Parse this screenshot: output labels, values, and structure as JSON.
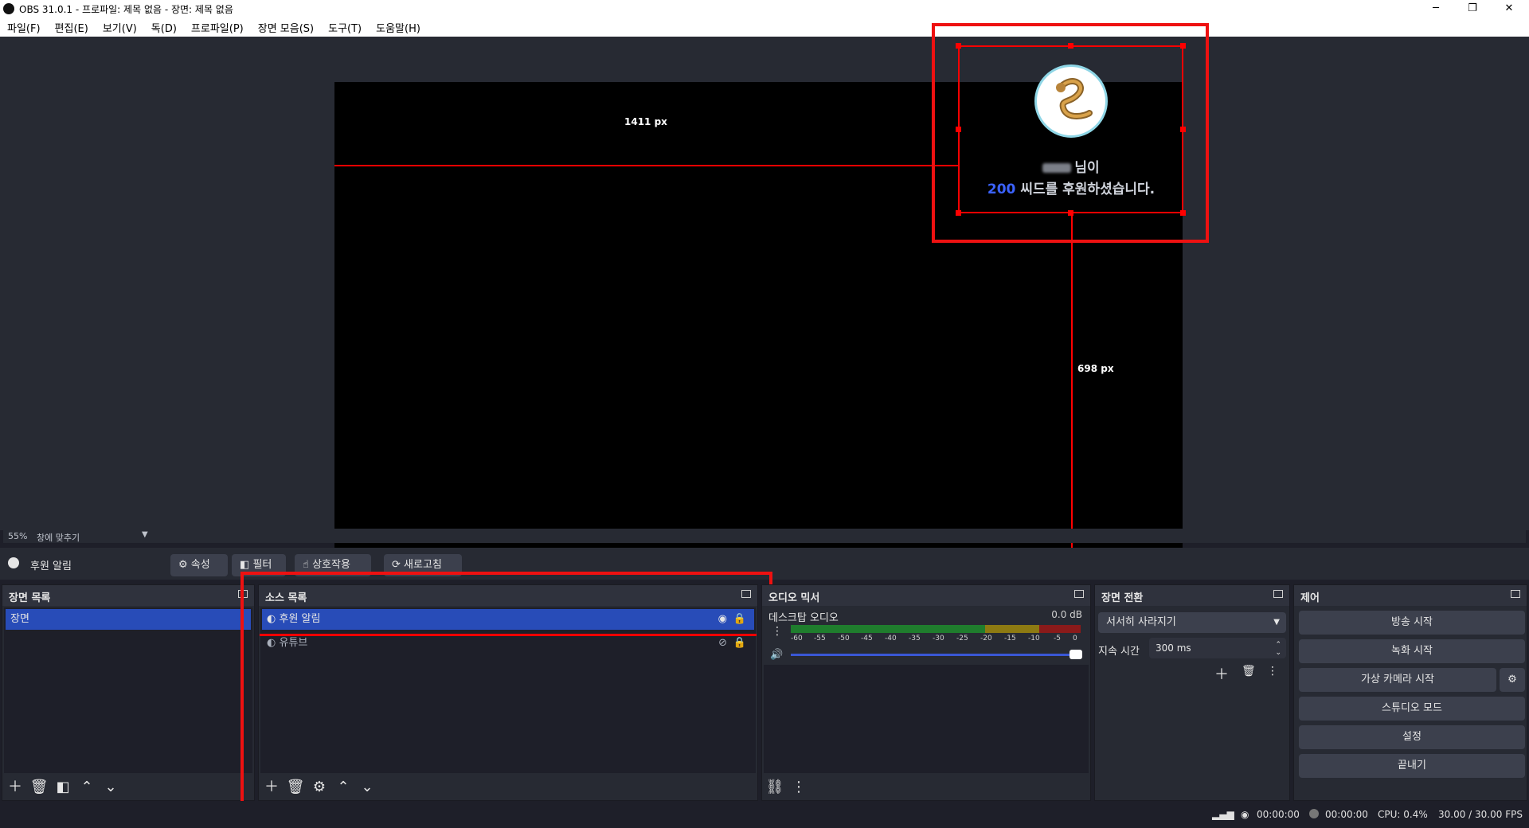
{
  "window": {
    "title": "OBS 31.0.1 - 프로파일: 제목 없음 - 장면: 제목 없음",
    "minimize": "─",
    "restore": "❐",
    "close": "✕"
  },
  "menu": [
    "파일(F)",
    "편집(E)",
    "보기(V)",
    "독(D)",
    "프로파일(P)",
    "장면 모음(S)",
    "도구(T)",
    "도움말(H)"
  ],
  "preview": {
    "distance_h_label": "1411 px",
    "distance_v_label": "698 px",
    "alert": {
      "line1_suffix": "님이",
      "amount": "200",
      "line2_suffix": "씨드를 후원하셨습니다."
    },
    "zoom": "55%",
    "zoom_mode": "창에 맞추기"
  },
  "source_toolbar": {
    "selected_source": "후원 알림",
    "properties": "속성",
    "filters": "필터",
    "interact": "상호작용",
    "refresh": "새로고침"
  },
  "scenes_dock": {
    "title": "장면 목록",
    "items": [
      "장면"
    ]
  },
  "sources_dock": {
    "title": "소스 목록",
    "items": [
      {
        "name": "후원 알림",
        "visible": true,
        "selected": true
      },
      {
        "name": "유튜브",
        "visible": false,
        "selected": false
      }
    ]
  },
  "mixer_dock": {
    "title": "오디오 믹서",
    "track_name": "데스크탑 오디오",
    "level": "0.0 dB",
    "ticks": [
      "-60",
      "-55",
      "-50",
      "-45",
      "-40",
      "-35",
      "-30",
      "-25",
      "-20",
      "-15",
      "-10",
      "-5",
      "0"
    ]
  },
  "transitions_dock": {
    "title": "장면 전환",
    "transition": "서서히 사라지기",
    "duration_label": "지속 시간",
    "duration_value": "300 ms"
  },
  "controls_dock": {
    "title": "제어",
    "buttons": [
      "방송 시작",
      "녹화 시작",
      "가상 카메라 시작",
      "스튜디오 모드",
      "설정",
      "끝내기"
    ]
  },
  "status": {
    "stream_time": "00:00:00",
    "record_time": "00:00:00",
    "cpu": "CPU: 0.4%",
    "fps": "30.00 / 30.00 FPS"
  },
  "colors": {
    "selection": "#284cb8",
    "annotation_red": "#ee1111",
    "alert_amount": "#3b62ff"
  }
}
